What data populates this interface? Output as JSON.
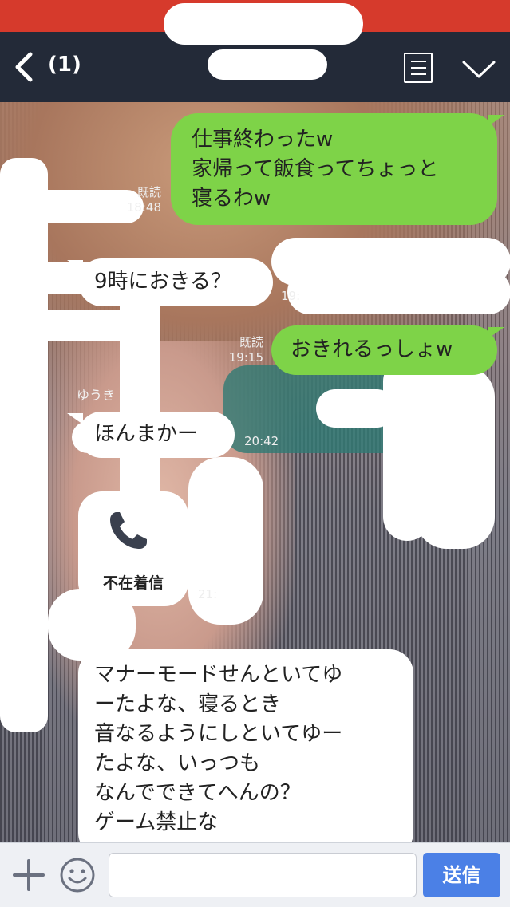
{
  "header": {
    "unread_count": "(1)"
  },
  "messages": [
    {
      "direction": "out",
      "text": "仕事終わったw\n家帰って飯食ってちょっと\n寝るわw",
      "read": "既読",
      "time": "18:48"
    },
    {
      "direction": "in",
      "text": "9時におきる？",
      "time": "19:"
    },
    {
      "direction": "out",
      "text": "おきれるっしょw",
      "read": "既読",
      "time": "19:15"
    },
    {
      "direction": "in",
      "text": "ほんまかー",
      "time": "20:42"
    },
    {
      "direction": "in",
      "type": "call",
      "text": "不在着信",
      "time": "21:"
    },
    {
      "direction": "in",
      "text": "マナーモードせんといてゆ\nーたよな、寝るとき\n音なるようにしといてゆー\nたよな、いっつも\nなんでできてへんの？\nゲーム禁止な"
    }
  ],
  "sender_name": "ゆうき",
  "input": {
    "placeholder": "",
    "send_label": "送信"
  },
  "colors": {
    "header_bg": "#232a38",
    "status_strip": "#d63a2c",
    "outgoing_bubble": "#7ed348",
    "incoming_bubble": "#ffffff",
    "send_button": "#4b80e6"
  },
  "icons": [
    "back-icon",
    "menu-icon",
    "chevron-down-icon",
    "phone-icon",
    "plus-icon",
    "smiley-icon"
  ]
}
